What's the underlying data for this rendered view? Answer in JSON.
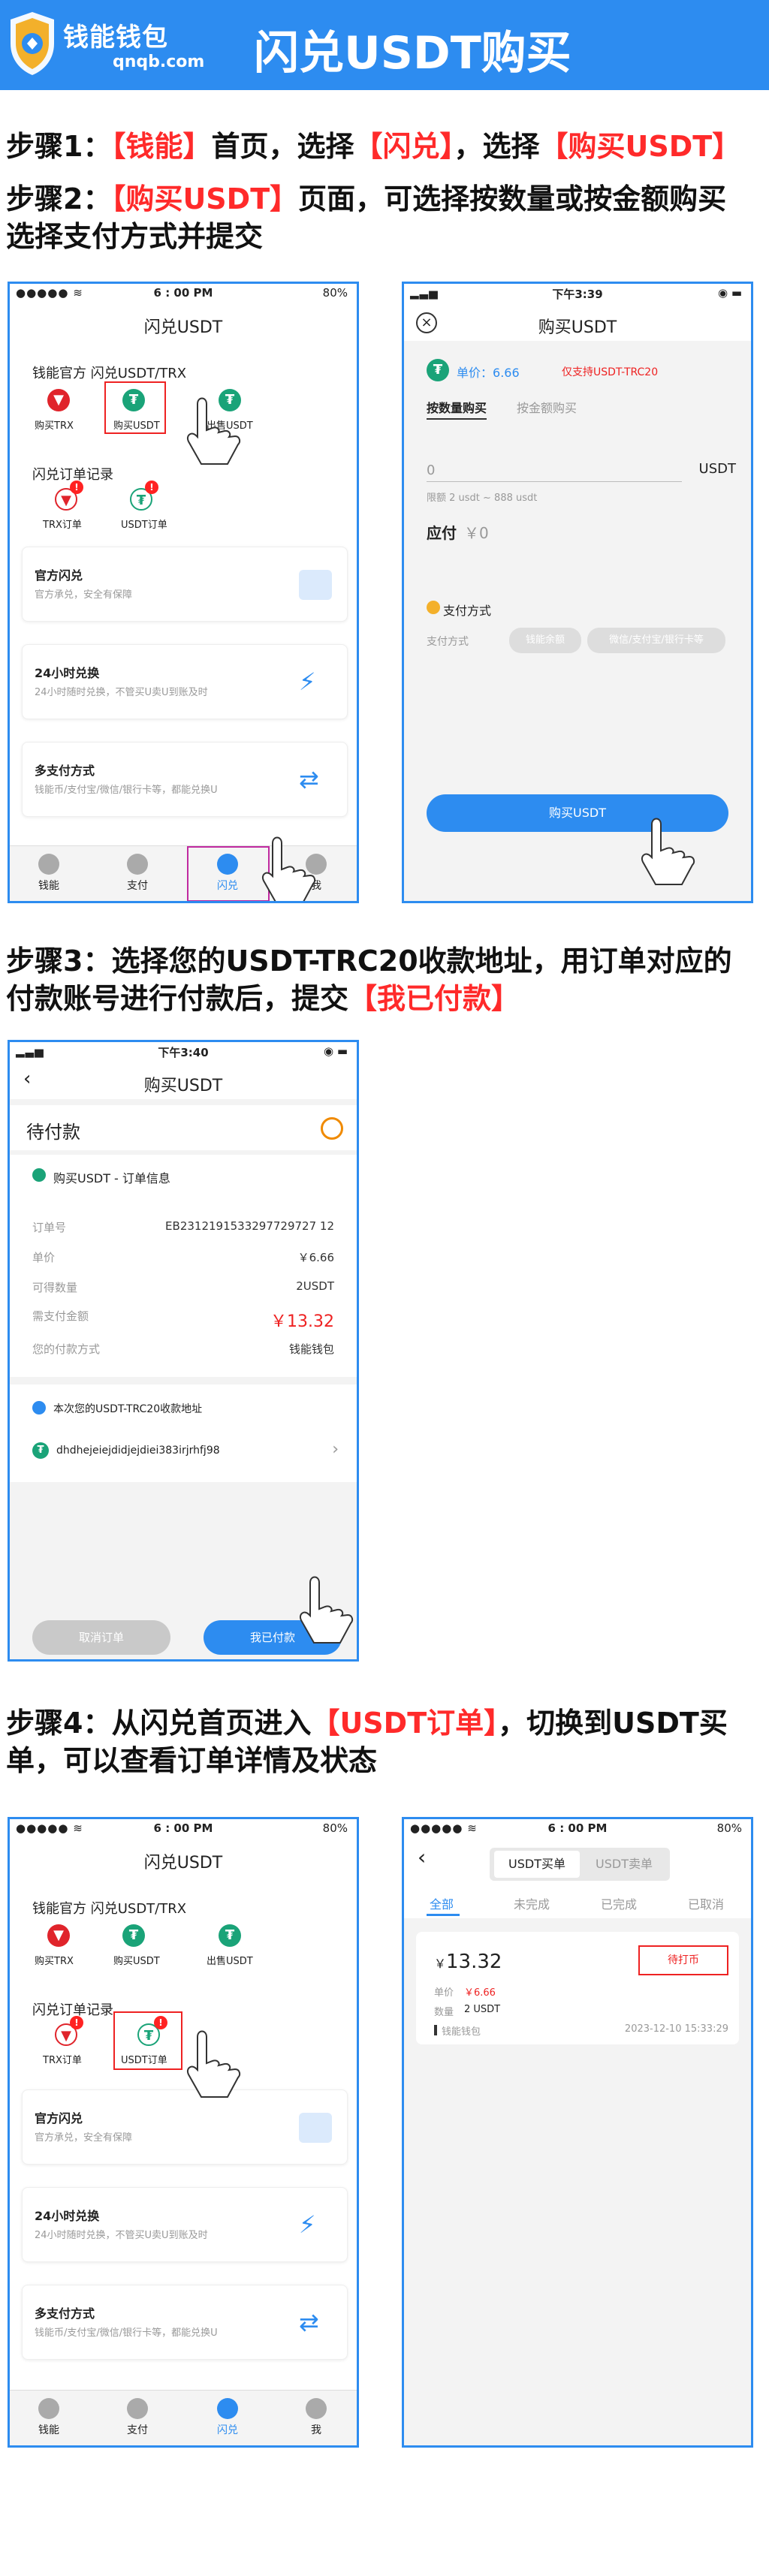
{
  "banner": {
    "logo_cn": "钱能钱包",
    "logo_en": "qnqb.com",
    "title": "闪兑USDT购买"
  },
  "steps": {
    "s1": {
      "a": "步骤1：",
      "b": "【钱能】",
      "c": "首页，选择",
      "d": "【闪兑】",
      "e": "，选择",
      "f": "【购买USDT】"
    },
    "s2": {
      "a": "步骤2：",
      "b": "【购买USDT】",
      "c": "页面，可选择按数量或按金额购买",
      "line2": "选择支付方式并提交"
    },
    "s3": {
      "line1": "步骤3：选择您的USDT-TRC20收款地址，用订单对应的",
      "line2a": "付款账号进行付款后，提交",
      "line2b": "【我已付款】"
    },
    "s4": {
      "a": "步骤4：从闪兑首页进入",
      "b": "【USDT订单】",
      "c": "，切换到USDT买",
      "line2": "单，可以查看订单详情及状态"
    }
  },
  "p1": {
    "status": {
      "left": "●●●●● ≋",
      "center": "6 : 00 PM",
      "right": "80%"
    },
    "title": "闪兑USDT",
    "section1": "钱能官方 闪兑USDT/TRX",
    "actions": [
      "购买TRX",
      "购买USDT",
      "出售USDT"
    ],
    "section2": "闪兑订单记录",
    "orders": [
      "TRX订单",
      "USDT订单"
    ],
    "badge": "!",
    "cards": [
      {
        "title": "官方闪兑",
        "sub": "官方承兑，安全有保障"
      },
      {
        "title": "24小时兑换",
        "sub": "24小时随时兑换，不管买U卖U到账及时"
      },
      {
        "title": "多支付方式",
        "sub": "钱能币/支付宝/微信/银行卡等，都能兑换U"
      }
    ],
    "tabs": [
      "钱能",
      "支付",
      "闪兑",
      "我"
    ]
  },
  "p2": {
    "status": {
      "left": "▂▃▅",
      "center": "下午3:39",
      "right": "◉ ▬"
    },
    "title": "购买USDT",
    "price_label": "单价：",
    "price": "6.66",
    "support": "仅支持USDT-TRC20",
    "tab_qty": "按数量购买",
    "tab_amt": "按金额购买",
    "qty_value": "0",
    "unit": "USDT",
    "limit": "限额 2 usdt ~ 888 usdt",
    "pay_label": "应付",
    "pay_value": "￥0",
    "paymethod_title": "支付方式",
    "paymethod_label": "支付方式",
    "methods": [
      "钱能余额",
      "微信/支付宝/银行卡等"
    ],
    "submit": "购买USDT"
  },
  "p3": {
    "status": {
      "left": "▂▃▅",
      "center": "下午3:40",
      "right": "◉ ▬"
    },
    "title": "购买USDT",
    "state": "待付款",
    "info_title": "购买USDT - 订单信息",
    "rows": [
      {
        "k": "订单号",
        "v": "EB2312191533297729727 12"
      },
      {
        "k": "单价",
        "v": "￥6.66"
      },
      {
        "k": "可得数量",
        "v": "2USDT"
      },
      {
        "k": "需支付金额",
        "v": "￥13.32"
      },
      {
        "k": "您的付款方式",
        "v": "钱能钱包"
      }
    ],
    "addr_title": "本次您的USDT-TRC20收款地址",
    "address": "dhdhejeiejdidjejdiei383irjrhfj98",
    "cancel": "取消订单",
    "paid": "我已付款"
  },
  "p4": {
    "status": {
      "left": "●●●●● ≋",
      "center": "6 : 00 PM",
      "right": "80%"
    },
    "title": "闪兑USDT",
    "section1": "钱能官方 闪兑USDT/TRX",
    "actions": [
      "购买TRX",
      "购买USDT",
      "出售USDT"
    ],
    "section2": "闪兑订单记录",
    "orders": [
      "TRX订单",
      "USDT订单"
    ],
    "badge": "!",
    "cards": [
      {
        "title": "官方闪兑",
        "sub": "官方承兑，安全有保障"
      },
      {
        "title": "24小时兑换",
        "sub": "24小时随时兑换，不管买U卖U到账及时"
      },
      {
        "title": "多支付方式",
        "sub": "钱能币/支付宝/微信/银行卡等，都能兑换U"
      }
    ],
    "tabs": [
      "钱能",
      "支付",
      "闪兑",
      "我"
    ]
  },
  "p5": {
    "status": {
      "left": "●●●●● ≋",
      "center": "6 : 00 PM",
      "right": "80%"
    },
    "seg": [
      "USDT买单",
      "USDT卖单"
    ],
    "filters": [
      "全部",
      "未完成",
      "已完成",
      "已取消"
    ],
    "order": {
      "amount": "13.32",
      "currency": "￥",
      "price_label": "单价",
      "price": "￥6.66",
      "qty_label": "数量",
      "qty": "2 USDT",
      "method": "钱能钱包",
      "time": "2023-12-10 15:33:29",
      "status": "待打币"
    }
  },
  "colors": {
    "brand": "#2d8cf0",
    "accent_red": "#ff2a2a",
    "usdt_green": "#1aa378",
    "trx_red": "#e0242b"
  }
}
